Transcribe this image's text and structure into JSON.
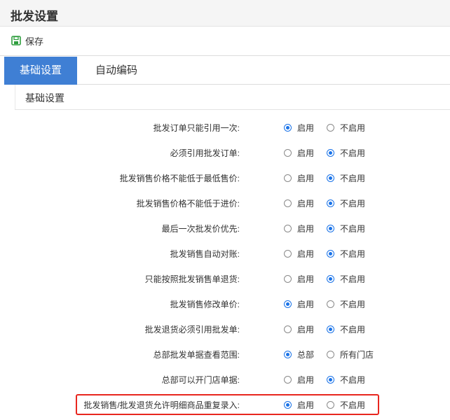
{
  "page": {
    "title": "批发设置"
  },
  "toolbar": {
    "save_label": "保存"
  },
  "tabs": [
    {
      "label": "基础设置",
      "active": true
    },
    {
      "label": "自动编码",
      "active": false
    }
  ],
  "section": {
    "title": "基础设置"
  },
  "settings": [
    {
      "label": "批发订单只能引用一次:",
      "opt1": "启用",
      "opt2": "不启用",
      "selected": 1
    },
    {
      "label": "必须引用批发订单:",
      "opt1": "启用",
      "opt2": "不启用",
      "selected": 2
    },
    {
      "label": "批发销售价格不能低于最低售价:",
      "opt1": "启用",
      "opt2": "不启用",
      "selected": 2
    },
    {
      "label": "批发销售价格不能低于进价:",
      "opt1": "启用",
      "opt2": "不启用",
      "selected": 2
    },
    {
      "label": "最后一次批发价优先:",
      "opt1": "启用",
      "opt2": "不启用",
      "selected": 2
    },
    {
      "label": "批发销售自动对账:",
      "opt1": "启用",
      "opt2": "不启用",
      "selected": 2
    },
    {
      "label": "只能按照批发销售单退货:",
      "opt1": "启用",
      "opt2": "不启用",
      "selected": 2
    },
    {
      "label": "批发销售修改单价:",
      "opt1": "启用",
      "opt2": "不启用",
      "selected": 1
    },
    {
      "label": "批发退货必须引用批发单:",
      "opt1": "启用",
      "opt2": "不启用",
      "selected": 2
    },
    {
      "label": "总部批发单据查看范围:",
      "opt1": "总部",
      "opt2": "所有门店",
      "selected": 1
    },
    {
      "label": "总部可以开门店单据:",
      "opt1": "启用",
      "opt2": "不启用",
      "selected": 2
    },
    {
      "label": "批发销售/批发退货允许明细商品重复录入:",
      "opt1": "启用",
      "opt2": "不启用",
      "selected": 1
    }
  ],
  "colors": {
    "accent": "#3f7fd4",
    "radio_selected": "#1a73e8",
    "highlight": "#e8261f",
    "save_icon": "#2e9e3e"
  }
}
